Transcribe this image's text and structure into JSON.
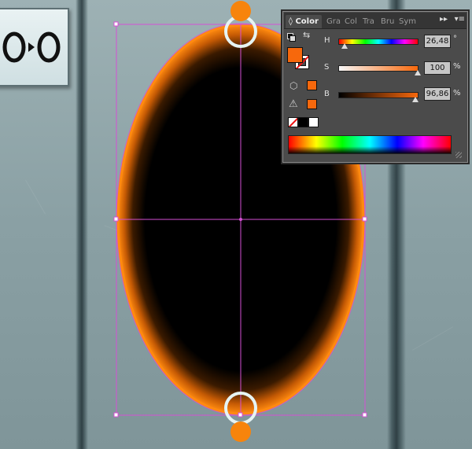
{
  "sign": {
    "symbol": "O▸O"
  },
  "panel": {
    "tabs": [
      {
        "label": "Color",
        "active": true
      },
      {
        "label": "Gra"
      },
      {
        "label": "Col"
      },
      {
        "label": "Tra"
      },
      {
        "label": "Bru"
      },
      {
        "label": "Sym"
      }
    ],
    "more_icon": "double-chevron-right-icon",
    "menu_icon": "panel-menu-icon",
    "sliders": [
      {
        "label": "H",
        "value": "26,48",
        "unit": "°",
        "thumb_fraction": 0.07
      },
      {
        "label": "S",
        "value": "100",
        "unit": "%",
        "thumb_fraction": 1.0
      },
      {
        "label": "B",
        "value": "96,86",
        "unit": "%",
        "thumb_fraction": 0.97
      }
    ],
    "fill_color": "#f7680c",
    "stroke": "none"
  },
  "colors": {
    "handle_orange": "#f7840c",
    "selection_magenta": "#d550d5",
    "portal_glow": "#f77b0a"
  }
}
